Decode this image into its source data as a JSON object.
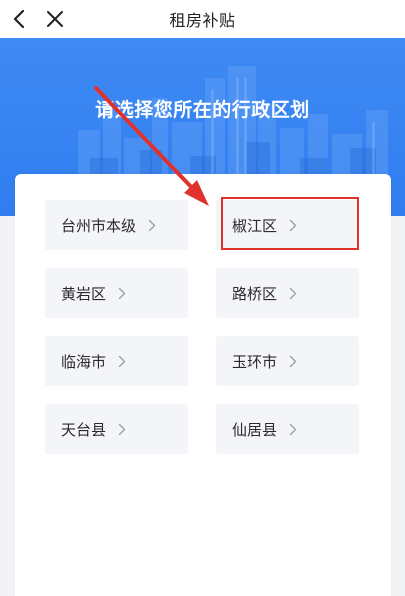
{
  "navbar": {
    "title": "租房补贴",
    "back_icon": "chevron-left-icon",
    "close_icon": "close-icon"
  },
  "hero": {
    "title": "请选择您所在的行政区划",
    "background_color": "#3480f1"
  },
  "regions": [
    {
      "label": "台州市本级"
    },
    {
      "label": "椒江区",
      "highlighted": true
    },
    {
      "label": "黄岩区"
    },
    {
      "label": "路桥区"
    },
    {
      "label": "临海市"
    },
    {
      "label": "玉环市"
    },
    {
      "label": "天台县"
    },
    {
      "label": "仙居县"
    }
  ],
  "annotation": {
    "highlight_color": "#e0322d",
    "arrow_color": "#e0322d"
  }
}
